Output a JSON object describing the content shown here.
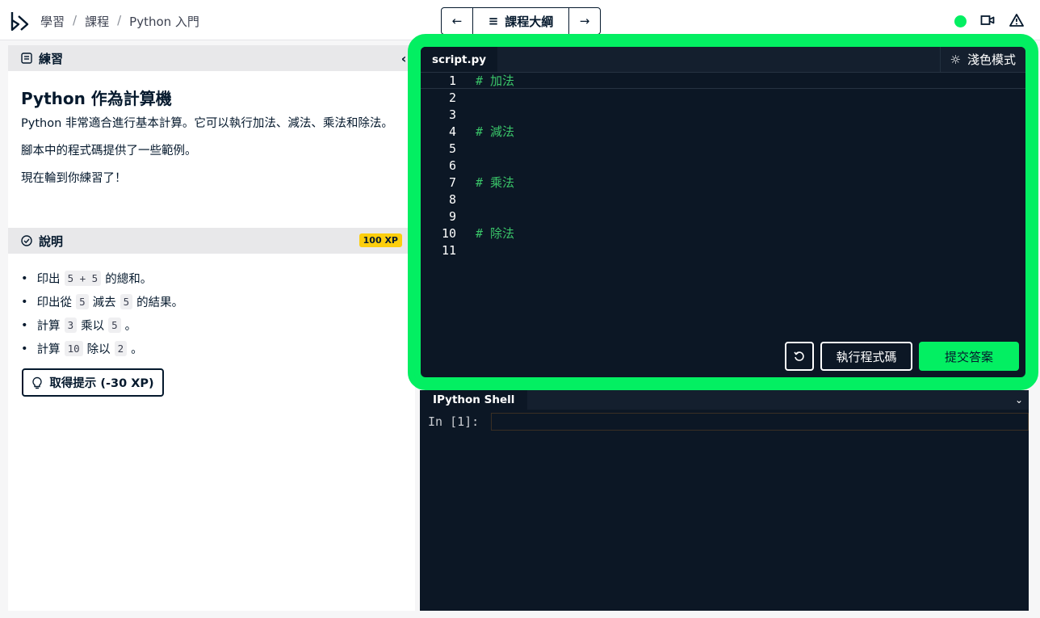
{
  "breadcrumb": {
    "items": [
      "學習",
      "課程",
      "Python 入門"
    ]
  },
  "nav": {
    "prev_icon": "←",
    "outline_label": "課程大綱",
    "next_icon": "→"
  },
  "status": {
    "color": "#03ef62"
  },
  "exercise": {
    "header": "練習",
    "collapse_icon": "‹",
    "title": "Python 作為計算機",
    "paragraphs": [
      "Python 非常適合進行基本計算。它可以執行加法、減法、乘法和除法。",
      "腳本中的程式碼提供了一些範例。",
      "現在輪到你練習了！"
    ]
  },
  "instructions": {
    "header": "說明",
    "xp_badge": "100 XP",
    "items": [
      {
        "pre": "印出",
        "code": "5 + 5",
        "post": "的總和。"
      },
      {
        "pre": "印出從",
        "code": "5",
        "mid": "減去",
        "code2": "5",
        "post": "的結果。"
      },
      {
        "pre": "計算",
        "code": "3",
        "mid": "乘以",
        "code2": "5",
        "post": "。"
      },
      {
        "pre": "計算",
        "code": "10",
        "mid": "除以",
        "code2": "2",
        "post": "。"
      }
    ],
    "hint_label": "取得提示 (-30 XP)"
  },
  "editor": {
    "tab": "script.py",
    "theme_label": "淺色模式",
    "lines": [
      {
        "n": "1",
        "text": "# 加法"
      },
      {
        "n": "2",
        "text": ""
      },
      {
        "n": "3",
        "text": ""
      },
      {
        "n": "4",
        "text": "# 減法"
      },
      {
        "n": "5",
        "text": ""
      },
      {
        "n": "6",
        "text": ""
      },
      {
        "n": "7",
        "text": "# 乘法"
      },
      {
        "n": "8",
        "text": ""
      },
      {
        "n": "9",
        "text": ""
      },
      {
        "n": "10",
        "text": "# 除法"
      },
      {
        "n": "11",
        "text": ""
      }
    ],
    "run_label": "執行程式碼",
    "submit_label": "提交答案",
    "highlight_color": "#03ef62"
  },
  "shell": {
    "tab": "IPython Shell",
    "prompt": "In [1]:"
  }
}
